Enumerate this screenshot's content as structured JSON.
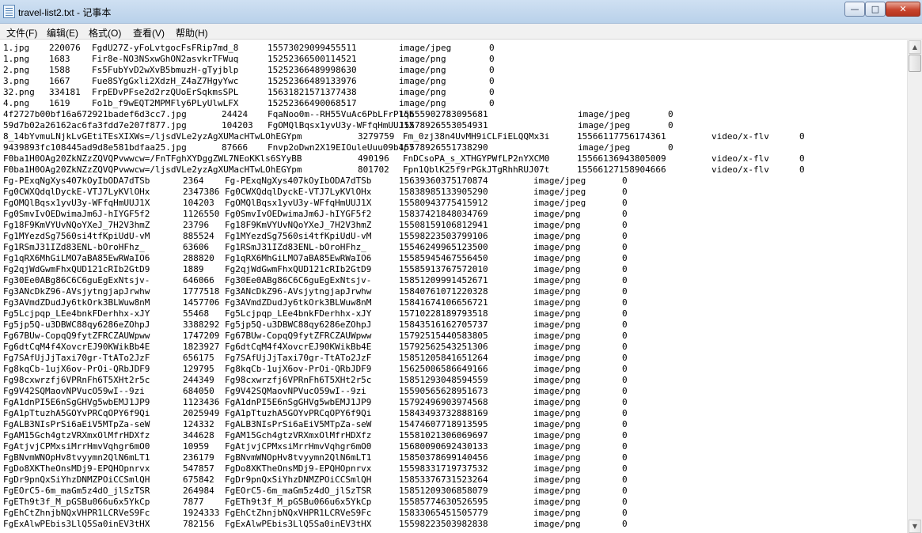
{
  "window": {
    "title": "travel-list2.txt - 记事本",
    "minimize_glyph": "—",
    "maximize_glyph": "□",
    "close_glyph": "✕"
  },
  "menu": [
    "文件(F)",
    "编辑(E)",
    "格式(O)",
    "查看(V)",
    "帮助(H)"
  ],
  "scrollbar": {
    "up_glyph": "▲",
    "down_glyph": "▼"
  },
  "lines": [
    [
      "1.jpg",
      "220076",
      "FgdU27Z-yFoLvtgocFsFRip7md_8",
      "15573029099455511",
      "image/jpeg",
      "0"
    ],
    [
      "1.png",
      "1683",
      "Fir8e-NO3NSxwGhON2asvkrTFWuq",
      "15252366500114521",
      "image/png",
      "0"
    ],
    [
      "2.png",
      "1588",
      "Fs5FubYvD2wXvB5bmuzH-gTyjblp",
      "15252366489998630",
      "image/png",
      "0"
    ],
    [
      "3.png",
      "1667",
      "Fue8SYgGxli2XdzH_Z4aZ7HgyYwc",
      "15252366489133976",
      "image/png",
      "0"
    ],
    [
      "32.png",
      "334181",
      "FrpEDvPFse2d2rzQUoErSqkmsSPL",
      "15631821571377438",
      "image/png",
      "0"
    ],
    [
      "4.png",
      "1619",
      "Fo1b_f9wEQT2MPMFly6PLyUlwLFX",
      "15252366490068517",
      "image/png",
      "0"
    ],
    [
      "4f2727b00bf16a672921badef6d3cc7.jpg",
      "24424",
      "FqaNoo0m--RH55VuAc6PbLFrPlqh",
      "15655902783095681",
      "image/jpeg",
      "0"
    ],
    [
      "59d7b02a26162ac6fa3fdd7e207f877.jpg",
      "104203",
      "FgOMQlBqsx1yvU3y-WFfqHmUUJ1X",
      "15578926553054931",
      "image/jpeg",
      "0"
    ],
    [
      "8_14bYvmuLNjkLvGEtiTEsXIXWs=/ljsdVLe2yzAgXUMacHTwLOhEGYpm",
      "3279759",
      "Fm_0zj38n4UvMH9iCLFiELQQMx3i",
      "15566117756174361",
      "video/x-flv",
      "0"
    ],
    [
      "9439893fc108445ad9d8e581bdfaa25.jpg",
      "87666",
      "Fnvp2oDwn2X19EIOuleUuu09b4p7",
      "15578926551738290",
      "image/jpeg",
      "0"
    ],
    [
      "F0ba1H0OAg20ZkNZzZQVQPvwwcw=/FnTFghXYDggZWL7NEoKKls6SYyBB",
      "490196",
      "FnDCsoPA_s_XTHGYPWfLP2nYXCM0",
      "15566136943805009",
      "video/x-flv",
      "0"
    ],
    [
      "F0ba1H0OAg20ZkNZzZQVQPvwwcw=/ljsdVLe2yzAgXUMacHTwLOhEGYpm",
      "801702",
      "Fpn1QblK25f9rPGkJTgRhhRUJ07t",
      "15566127158904666",
      "video/x-flv",
      "0"
    ],
    [
      "Fg-PExqNgXys407kOyIbODA7dTSb",
      "2364",
      "Fg-PExqNgXys407kOyIbODA7dTSb",
      "15639360375170874",
      "image/jpeg",
      "0"
    ],
    [
      "Fg0CWXQdqlDyckE-VTJ7LyKVlOHx",
      "2347386",
      "Fg0CWXQdqlDyckE-VTJ7LyKVlOHx",
      "15838985133905290",
      "image/jpeg",
      "0"
    ],
    [
      "FgOMQlBqsx1yvU3y-WFfqHmUUJ1X",
      "104203",
      "FgOMQlBqsx1yvU3y-WFfqHmUUJ1X",
      "15580943775415912",
      "image/jpeg",
      "0"
    ],
    [
      "Fg0SmvIvOEDwimaJm6J-hIYGF5f2",
      "1126550",
      "Fg0SmvIvOEDwimaJm6J-hIYGF5f2",
      "15837421848034769",
      "image/png",
      "0"
    ],
    [
      "Fg18F9KmVYUvNQoYXeJ_7H2V3hmZ",
      "23796",
      "Fg18F9KmVYUvNQoYXeJ_7H2V3hmZ",
      "15508159106812941",
      "image/png",
      "0"
    ],
    [
      "Fg1MYezdSg7560si4tfKpiUdU-vM",
      "885524",
      "Fg1MYezdSg7560si4tfKpiUdU-vM",
      "15598223503799106",
      "image/png",
      "0"
    ],
    [
      "Fg1RSmJ31IZd83ENL-bOroHFhz_",
      "63606",
      "Fg1RSmJ31IZd83ENL-bOroHFhz_",
      "15546249965123500",
      "image/png",
      "0"
    ],
    [
      "Fg1qRX6MhGiLMO7aBA85EwRWaIO6",
      "288820",
      "Fg1qRX6MhGiLMO7aBA85EwRWaIO6",
      "15585945467556450",
      "image/png",
      "0"
    ],
    [
      "Fg2qjWdGwmFhxQUD121cRIb2GtD9",
      "1889",
      "Fg2qjWdGwmFhxQUD121cRIb2GtD9",
      "15585913767572010",
      "image/png",
      "0"
    ],
    [
      "Fg30Ee0ABg86C6C6guEgExNtsjv-",
      "646066",
      "Fg30Ee0ABg86C6C6guEgExNtsjv-",
      "15851209991452671",
      "image/png",
      "0"
    ],
    [
      "Fg3ANcDkZ96-AVsjytngjapJrwhw",
      "1777518",
      "Fg3ANcDkZ96-AVsjytngjapJrwhw",
      "15840761071220328",
      "image/png",
      "0"
    ],
    [
      "Fg3AVmdZDudJy6tkOrk3BLWuw8nM",
      "1457706",
      "Fg3AVmdZDudJy6tkOrk3BLWuw8nM",
      "15841674106656721",
      "image/png",
      "0"
    ],
    [
      "Fg5Lcjpqp_LEe4bnkFDerhhx-xJY",
      "55468",
      "Fg5Lcjpqp_LEe4bnkFDerhhx-xJY",
      "15710228189793518",
      "image/png",
      "0"
    ],
    [
      "Fg5jp5Q-u3DBWC88qy6286eZOhpJ",
      "3388292",
      "Fg5jp5Q-u3DBWC88qy6286eZOhpJ",
      "15843516162705737",
      "image/png",
      "0"
    ],
    [
      "Fg67BUw-CopqQ9fytZFRCZAUWpww",
      "1747209",
      "Fg67BUw-CopqQ9fytZFRCZAUWpww",
      "15792515440583805",
      "image/png",
      "0"
    ],
    [
      "Fg6dtCqM4f4XovcrEJ90KWikBb4E",
      "1823927",
      "Fg6dtCqM4f4XovcrEJ90KWikBb4E",
      "15792562543251306",
      "image/png",
      "0"
    ],
    [
      "Fg7SAfUjJjTaxi70gr-TtATo2JzF",
      "656175",
      "Fg7SAfUjJjTaxi70gr-TtATo2JzF",
      "15851205841651264",
      "image/png",
      "0"
    ],
    [
      "Fg8kqCb-1ujX6ov-PrOi-QRbJDF9",
      "129795",
      "Fg8kqCb-1ujX6ov-PrOi-QRbJDF9",
      "15625006586649166",
      "image/png",
      "0"
    ],
    [
      "Fg98cxwrzfj6VPRnFh6T5XHt2r5c",
      "244349",
      "Fg98cxwrzfj6VPRnFh6T5XHt2r5c",
      "15851293048594559",
      "image/png",
      "0"
    ],
    [
      "Fg9V42SQMaovNPVucO59wI--9zi",
      "684050",
      "Fg9V42SQMaovNPVucO59wI--9zi",
      "15590565628951673",
      "image/png",
      "0"
    ],
    [
      "FgA1dnPI5E6nSgGHVg5wbEMJ1JP9",
      "1123436",
      "FgA1dnPI5E6nSgGHVg5wbEMJ1JP9",
      "15792496903974568",
      "image/png",
      "0"
    ],
    [
      "FgA1pTtuzhA5GOYvPRCqOPY6f9Qi",
      "2025949",
      "FgA1pTtuzhA5GOYvPRCqOPY6f9Qi",
      "15843493732888169",
      "image/png",
      "0"
    ],
    [
      "FgALB3NIsPrSi6aEiV5MTpZa-seW",
      "124332",
      "FgALB3NIsPrSi6aEiV5MTpZa-seW",
      "15474607718913595",
      "image/png",
      "0"
    ],
    [
      "FgAM15Gch4gtzVRXmxOlMfrHDXfz",
      "344628",
      "FgAM15Gch4gtzVRXmxOlMfrHDXfz",
      "15581021306069697",
      "image/png",
      "0"
    ],
    [
      "FgAtjvjCPMxsiMrrHmvVqhgr6mO0",
      "10959",
      "FgAtjvjCPMxsiMrrHmvVqhgr6mO0",
      "15680090692430133",
      "image/png",
      "0"
    ],
    [
      "FgBNvmWNOpHv8tvyymn2QlN6mLT1",
      "236179",
      "FgBNvmWNOpHv8tvyymn2QlN6mLT1",
      "15850378699140456",
      "image/png",
      "0"
    ],
    [
      "FgDo8XKTheOnsMDj9-EPQHOpnrvx",
      "547857",
      "FgDo8XKTheOnsMDj9-EPQHOpnrvx",
      "15598331719737532",
      "image/png",
      "0"
    ],
    [
      "FgDr9pnQxSiYhzDNMZPOiCCSmlQH",
      "675842",
      "FgDr9pnQxSiYhzDNMZPOiCCSmlQH",
      "15853376731523264",
      "image/png",
      "0"
    ],
    [
      "FgEOrC5-6m_maGm5z4dO_jlSzTSR",
      "264984",
      "FgEOrC5-6m_maGm5z4dO_jlSzTSR",
      "15851209306858079",
      "image/png",
      "0"
    ],
    [
      "FgETh9t3f_M_pGSBu066u6x5YkCp",
      "7877",
      "FgETh9t3f_M_pGSBu066u6x5YkCp",
      "15585774630526595",
      "image/png",
      "0"
    ],
    [
      "FgEhCtZhnjbNQxVHPR1LCRVeS9Fc",
      "1924333",
      "FgEhCtZhnjbNQxVHPR1LCRVeS9Fc",
      "15833065451505779",
      "image/png",
      "0"
    ],
    [
      "FgExAlwPEbis3LlQ5Sa0inEV3tHX",
      "782156",
      "FgExAlwPEbis3LlQ5Sa0inEV3tHX",
      "15598223503982838",
      "image/png",
      "0"
    ]
  ]
}
